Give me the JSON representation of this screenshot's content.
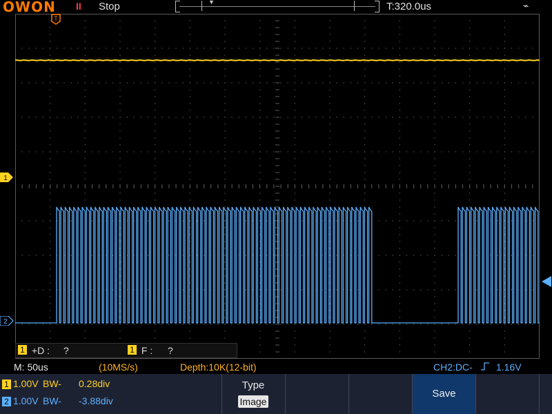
{
  "header": {
    "logo": "OWON",
    "run_state": "Stop",
    "time_position": "T:320.0us"
  },
  "screen": {
    "ch1_marker": "1",
    "ch2_marker": "2",
    "trigger_marker": "T"
  },
  "measurements": [
    {
      "channel": "1",
      "label": "+D :",
      "value": "?"
    },
    {
      "channel": "1",
      "label": "F :",
      "value": "?"
    }
  ],
  "status": {
    "timebase": "M: 50us",
    "sample_rate": "(10MS/s)",
    "depth": "Depth:10K(12-bit)",
    "trigger": "CH2:DC-",
    "trigger_level": "1.16V"
  },
  "channels": [
    {
      "id": "1",
      "volts": "1.00V",
      "bw": "BW-",
      "offset": "0.28div",
      "color": "#ffd21f"
    },
    {
      "id": "2",
      "volts": "1.00V",
      "bw": "BW-",
      "offset": "-3.88div",
      "color": "#5cb0ff"
    }
  ],
  "menu": {
    "type_label": "Type",
    "type_value": "Image",
    "save_label": "Save"
  },
  "colors": {
    "ch1": "#ffd21f",
    "ch2": "#5cb0ff",
    "grid": "#5a5a5a",
    "accent": "#ff7a00"
  },
  "icons": {
    "run_state": "pause-icon",
    "usb": "usb-icon"
  }
}
